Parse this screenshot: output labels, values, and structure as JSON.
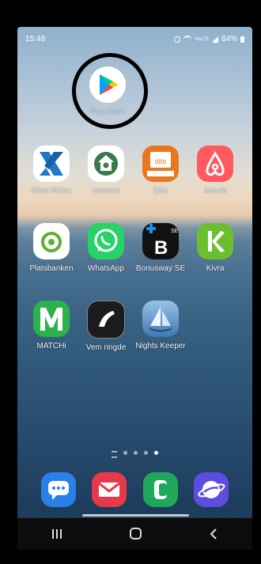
{
  "status_bar": {
    "time": "15:48",
    "network_label": "VoLTE",
    "battery": "84%"
  },
  "apps": [
    {
      "label": "Play Butik",
      "icon": "play-store-icon"
    },
    {
      "label": "Mina förfon",
      "icon": "x-logo-icon"
    },
    {
      "label": "Hemnet",
      "icon": "hemnet-house-icon"
    },
    {
      "label": "Dito",
      "icon": "dito-book-icon"
    },
    {
      "label": "Airbnb",
      "icon": "airbnb-icon"
    },
    {
      "label": "Platsbanken",
      "icon": "platsbanken-icon"
    },
    {
      "label": "WhatsApp",
      "icon": "whatsapp-icon"
    },
    {
      "label": "Bonusway SE",
      "icon": "bonusway-icon"
    },
    {
      "label": "Kivra",
      "icon": "kivra-icon"
    },
    {
      "label": "MATCHi",
      "icon": "matchi-icon"
    },
    {
      "label": "Vem ringde",
      "icon": "vem-ringde-icon"
    },
    {
      "label": "Nights Keeper",
      "icon": "nights-keeper-icon"
    }
  ],
  "dock": [
    {
      "name": "messages",
      "icon": "chat-bubble-icon",
      "color": "#2b7fe9"
    },
    {
      "name": "email",
      "icon": "envelope-icon",
      "color": "#e8394a"
    },
    {
      "name": "phone",
      "icon": "phone-icon",
      "color": "#1fa85a"
    },
    {
      "name": "internet",
      "icon": "planet-icon",
      "color": "#5b4de0"
    }
  ],
  "colors": {
    "hemnet": "#3a7a4a",
    "dito": "#e87722",
    "airbnb": "#ff5a5f",
    "whatsapp": "#25d366",
    "bonusway": "#111111",
    "kivra": "#6bbf2f",
    "matchi": "#2bb24c"
  },
  "page_indicator": {
    "count": 4,
    "active_index": 3
  }
}
